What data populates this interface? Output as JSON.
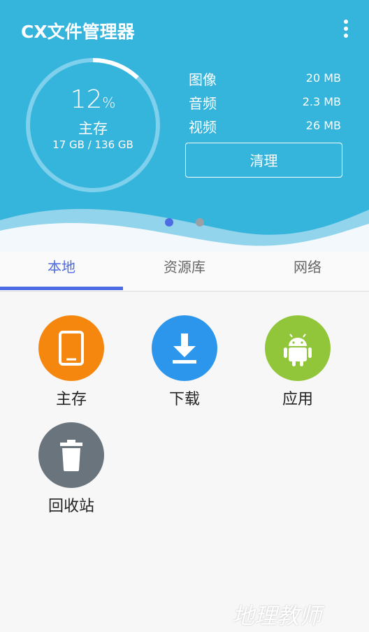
{
  "app": {
    "title": "CX文件管理器"
  },
  "header": {
    "percent": "12",
    "percent_sign": "%",
    "storage_used_fraction": 0.12,
    "storage_label": "主存",
    "storage_amount": "17 GB / 136 GB",
    "stats": [
      {
        "name": "图像",
        "value": "20 MB"
      },
      {
        "name": "音频",
        "value": "2.3 MB"
      },
      {
        "name": "视频",
        "value": "26 MB"
      }
    ],
    "clean_label": "清理",
    "page_count": 2,
    "current_page": 1
  },
  "tabs": [
    {
      "label": "本地",
      "active": true
    },
    {
      "label": "资源库",
      "active": false
    },
    {
      "label": "网络",
      "active": false
    }
  ],
  "items": [
    {
      "label": "主存",
      "icon": "tablet-icon",
      "color": "#f5870f"
    },
    {
      "label": "下载",
      "icon": "download-icon",
      "color": "#2b96eb"
    },
    {
      "label": "应用",
      "icon": "android-icon",
      "color": "#92c63a"
    },
    {
      "label": "回收站",
      "icon": "trash-icon",
      "color": "#6a747c"
    }
  ],
  "watermark": "地理教师",
  "colors": {
    "header_bg": "#35b4dc",
    "accent": "#4d6be2"
  }
}
